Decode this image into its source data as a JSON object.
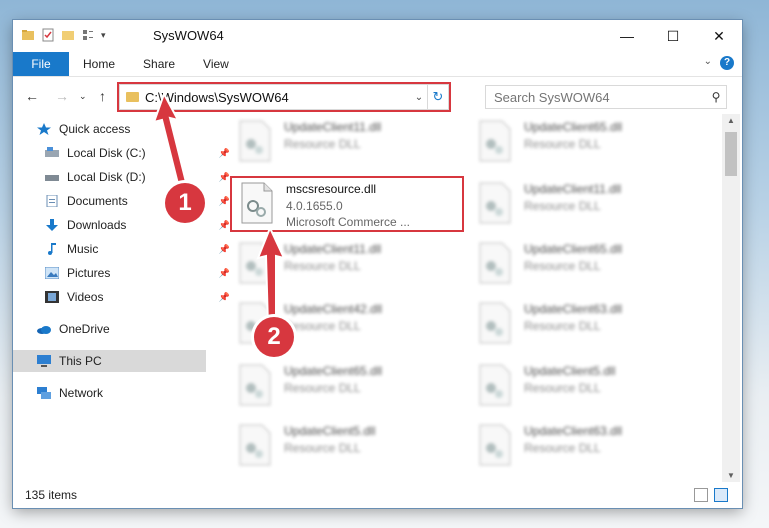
{
  "window": {
    "title": "SysWOW64"
  },
  "ribbon": {
    "file": "File",
    "tabs": [
      "Home",
      "Share",
      "View"
    ]
  },
  "address": {
    "path": "C:\\Windows\\SysWOW64"
  },
  "search": {
    "placeholder": "Search SysWOW64"
  },
  "sidebar": {
    "items": [
      {
        "label": "Quick access"
      },
      {
        "label": "Local Disk (C:)"
      },
      {
        "label": "Local Disk (D:)"
      },
      {
        "label": "Documents"
      },
      {
        "label": "Downloads"
      },
      {
        "label": "Music"
      },
      {
        "label": "Pictures"
      },
      {
        "label": "Videos"
      },
      {
        "label": "OneDrive"
      },
      {
        "label": "This PC"
      },
      {
        "label": "Network"
      }
    ]
  },
  "files": [
    {
      "name": "UpdateClient11.dll",
      "type": "Resource DLL"
    },
    {
      "name": "UpdateClient65.dll",
      "type": "Resource DLL"
    },
    {
      "name": "mscsresource.dll",
      "version": "4.0.1655.0",
      "desc": "Microsoft Commerce ..."
    },
    {
      "name": "UpdateClient11.dll",
      "type": "Resource DLL"
    },
    {
      "name": "UpdateClient11.dll",
      "type": "Resource DLL"
    },
    {
      "name": "UpdateClient65.dll",
      "type": "Resource DLL"
    },
    {
      "name": "UpdateClient42.dll",
      "type": "Resource DLL"
    },
    {
      "name": "UpdateClient63.dll",
      "type": "Resource DLL"
    },
    {
      "name": "UpdateClient65.dll",
      "type": "Resource DLL"
    },
    {
      "name": "UpdateClient5.dll",
      "type": "Resource DLL"
    },
    {
      "name": "UpdateClient5.dll",
      "type": "Resource DLL"
    },
    {
      "name": "UpdateClient63.dll",
      "type": "Resource DLL"
    }
  ],
  "status": {
    "count": "135 items"
  },
  "callouts": [
    "1",
    "2"
  ],
  "colors": {
    "accent": "#1979ca",
    "callout": "#d7373f"
  }
}
